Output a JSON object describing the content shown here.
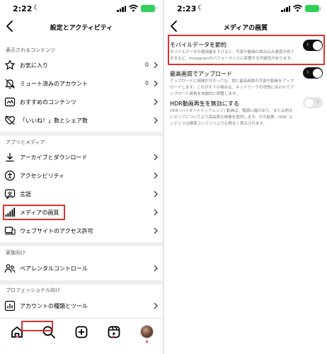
{
  "left": {
    "status": {
      "time": "2:22",
      "battery": ""
    },
    "title": "設定とアクティビティ",
    "sections": [
      {
        "header": "表示されるコンテンツ",
        "items": [
          {
            "label": "お気に入り",
            "count": "0"
          },
          {
            "label": "ミュート済みのアカウント",
            "count": "0"
          },
          {
            "label": "おすすめのコンテンツ",
            "count": ""
          },
          {
            "label": "「いいね！」数とシェア数",
            "count": ""
          }
        ]
      },
      {
        "header": "アプリとメディア",
        "items": [
          {
            "label": "アーカイブとダウンロード"
          },
          {
            "label": "アクセシビリティ"
          },
          {
            "label": "言語"
          },
          {
            "label": "メディアの画質"
          },
          {
            "label": "ウェブサイトのアクセス許可"
          }
        ]
      },
      {
        "header": "家族向け",
        "items": [
          {
            "label": "ペアレンタルコントロール"
          }
        ]
      },
      {
        "header": "プロフェッショナル向け",
        "items": [
          {
            "label": "アカウントの種類とツール"
          }
        ]
      }
    ]
  },
  "right": {
    "status": {
      "time": "2:23",
      "battery": ""
    },
    "title": "メディアの画質",
    "settings": [
      {
        "title": "モバイルデータを節約",
        "description": "モバイルデータの使用量を下げると、写真や動画の読み込み速度が低下するなど、Instagramのパフォーマンスに影響する可能性があります。",
        "enabled": true,
        "toggle_mark": "I"
      },
      {
        "title": "最高画質でアップロード",
        "description": "アップロードに時間がかかっても、常に最高画質の写真や動画をアップロードします。これがオフの場合は、ネットワークの状態に合わせてアップロード画質を自動的に調整します。",
        "enabled": true,
        "toggle_mark": "I"
      },
      {
        "title": "HDR動画再生を無効にする",
        "description": "HDR (ハイダイナミックレンジ) 動画は、階調に幅があり、または明るいエリアについてより高品質な映像を提供します。その結果、HDR コンテンツは標準コンテンツよりも明るく表示されます。",
        "enabled": false,
        "toggle_mark": "O"
      }
    ]
  },
  "bottom_nav": {
    "tabs": [
      "home",
      "search",
      "create",
      "reels",
      "profile"
    ]
  },
  "colors": {
    "highlight": "#e03030",
    "toggle_on": "#0f0f0f",
    "toggle_off": "#e6e6e6",
    "battery": "#30d158",
    "notification_dot": "#ff3040"
  }
}
